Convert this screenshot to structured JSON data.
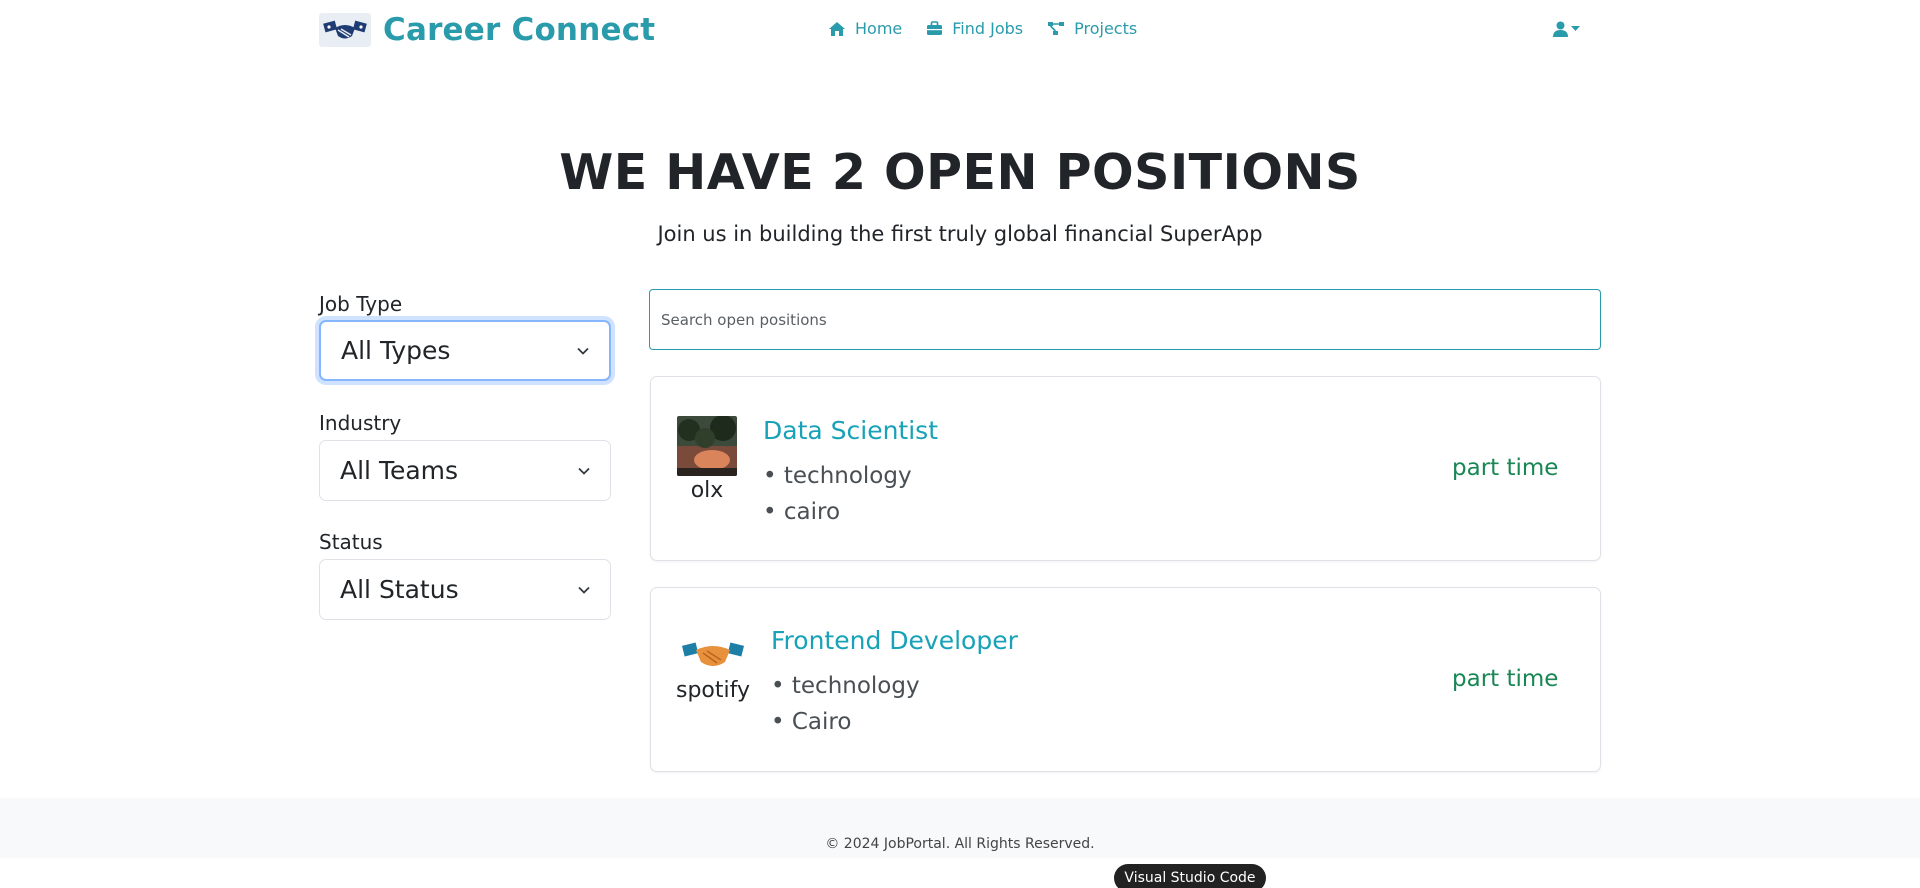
{
  "brand": {
    "name": "Career Connect",
    "logo_icon": "handshake-icon"
  },
  "nav": {
    "links": [
      {
        "label": "Home",
        "icon": "home-icon"
      },
      {
        "label": "Find Jobs",
        "icon": "briefcase-icon"
      },
      {
        "label": "Projects",
        "icon": "project-diagram-icon"
      }
    ],
    "user_icon": "user-icon"
  },
  "hero": {
    "title": "WE HAVE 2 OPEN POSITIONS",
    "subtitle": "Join us in building the first truly global financial SuperApp"
  },
  "filters": [
    {
      "label": "Job Type",
      "selected": "All Types"
    },
    {
      "label": "Industry",
      "selected": "All Teams"
    },
    {
      "label": "Status",
      "selected": "All Status"
    }
  ],
  "search": {
    "placeholder": "Search open positions",
    "value": ""
  },
  "jobs": [
    {
      "company": "olx",
      "title": "Data Scientist",
      "industry": "• technology",
      "location": "• cairo",
      "type": "part time"
    },
    {
      "company": "spotify",
      "title": "Frontend Developer",
      "industry": "• technology",
      "location": "• Cairo",
      "type": "part time"
    }
  ],
  "footer": {
    "text": "© 2024 JobPortal. All Rights Reserved."
  },
  "tooltip": {
    "text": "Visual Studio Code"
  },
  "colors": {
    "brand": "#2a9bab",
    "link": "#17a2b8",
    "success": "#198754",
    "focus": "#86b7fe"
  }
}
